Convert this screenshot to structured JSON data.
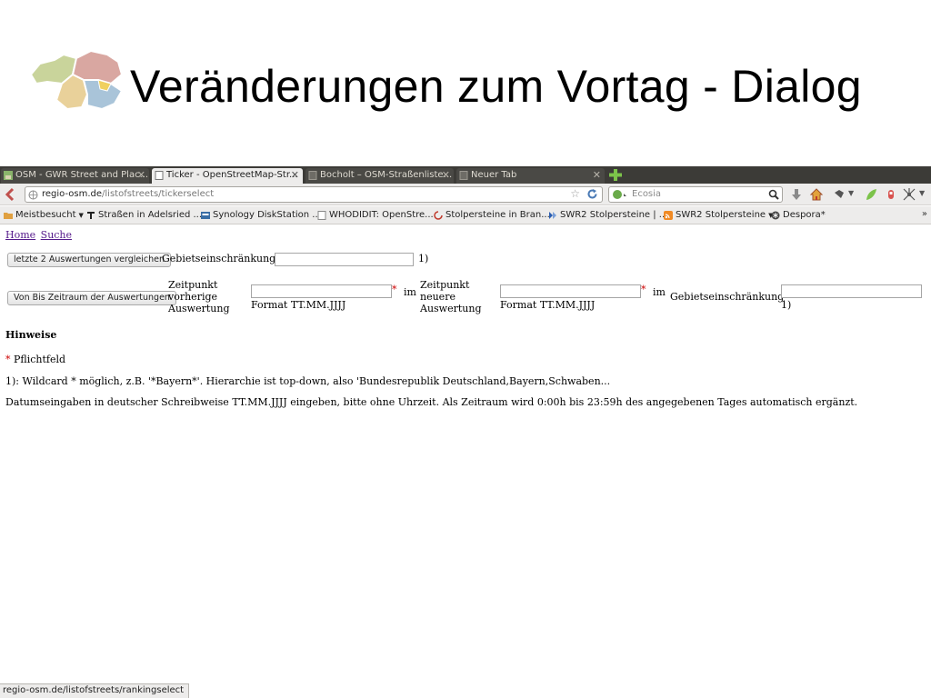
{
  "slide": {
    "title": "Veränderungen zum Vortag - Dialog"
  },
  "browser": {
    "tabs": [
      {
        "label": "OSM - GWR Street and Plac...",
        "active": false
      },
      {
        "label": "Ticker - OpenStreetMap-Str...",
        "active": true
      },
      {
        "label": "Bocholt – OSM-Straßenliste...",
        "active": false
      },
      {
        "label": "Neuer Tab",
        "active": false
      }
    ],
    "url": {
      "host": "regio-osm.de",
      "path": "/listofstreets/tickerselect"
    },
    "search": {
      "placeholder": "Ecosia"
    },
    "bookmarks": [
      {
        "label": "Meistbesucht",
        "dropdown": true
      },
      {
        "label": "Straßen in Adelsried ..."
      },
      {
        "label": "Synology DiskStation ..."
      },
      {
        "label": "WHODIDIT: OpenStre..."
      },
      {
        "label": "Stolpersteine in Bran..."
      },
      {
        "label": "SWR2 Stolpersteine | ..."
      },
      {
        "label": "SWR2 Stolpersteine",
        "dropdown": true
      },
      {
        "label": "Despora*"
      }
    ],
    "bookmarks_more": "»",
    "status_url": "regio-osm.de/listofstreets/rankingselect"
  },
  "page": {
    "nav": {
      "home": "Home",
      "search": "Suche"
    },
    "row1": {
      "button": "letzte 2 Auswertungen vergleichen",
      "label": "Gebietseinschränkung",
      "field_value": "",
      "note": "1)"
    },
    "row2": {
      "button": "Von Bis Zeitraum der Auswertungen",
      "from_label_lines": [
        "Zeitpunkt",
        "vorherige",
        "Auswertung"
      ],
      "from_value": "",
      "from_format": "Format TT.MM.JJJJ",
      "asterisk": "*",
      "im": "im",
      "to_label_lines": [
        "Zeitpunkt",
        "neuere",
        "Auswertung"
      ],
      "to_value": "",
      "to_format": "Format TT.MM.JJJJ",
      "area_label": "Gebietseinschränkung",
      "area_value": "",
      "area_note": "1)"
    },
    "hints": {
      "heading": "Hinweise",
      "required_marker": "*",
      "required_text": "Pflichtfeld",
      "wildcard": "1): Wildcard * möglich, z.B. '*Bayern*'. Hierarchie ist top-down, also 'Bundesrepublik Deutschland,Bayern,Schwaben...",
      "date": "Datumseingaben in deutscher Schreibweise TT.MM.JJJJ eingeben, bitte ohne Uhrzeit. Als Zeitraum wird 0:00h bis 23:59h des angegebenen Tages automatisch ergänzt."
    }
  }
}
